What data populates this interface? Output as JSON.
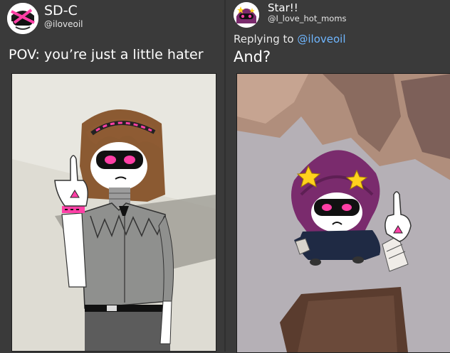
{
  "left_post": {
    "display_name": "SD-C",
    "handle": "@iloveoil",
    "text": "POV: you’re just a little hater",
    "avatar_icon": "avatar-sd-c",
    "image_alt": "drawing-character-middle-finger"
  },
  "right_post": {
    "display_name": "Star!!",
    "handle": "@I_love_hot_moms",
    "reply_prefix": "Replying to",
    "reply_mention": "@iloveoil",
    "text": "And?",
    "avatar_icon": "avatar-star",
    "image_alt": "drawing-character-looking-up"
  },
  "colors": {
    "background": "#3a3a3a",
    "mention": "#6fb6ff",
    "accent_pink": "#ff3fa6"
  }
}
